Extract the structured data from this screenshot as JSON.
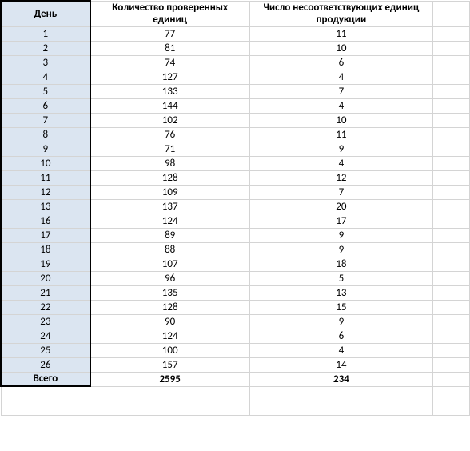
{
  "headers": {
    "day": "День",
    "checked": "Количество проверенных единиц",
    "defective": "Число несоответствующих единиц продукции"
  },
  "rows": [
    {
      "day": "1",
      "checked": "77",
      "defective": "11"
    },
    {
      "day": "2",
      "checked": "81",
      "defective": "10"
    },
    {
      "day": "3",
      "checked": "74",
      "defective": "6"
    },
    {
      "day": "4",
      "checked": "127",
      "defective": "4"
    },
    {
      "day": "5",
      "checked": "133",
      "defective": "7"
    },
    {
      "day": "6",
      "checked": "144",
      "defective": "4"
    },
    {
      "day": "7",
      "checked": "102",
      "defective": "10"
    },
    {
      "day": "8",
      "checked": "76",
      "defective": "11"
    },
    {
      "day": "9",
      "checked": "71",
      "defective": "9"
    },
    {
      "day": "10",
      "checked": "98",
      "defective": "4"
    },
    {
      "day": "11",
      "checked": "128",
      "defective": "12"
    },
    {
      "day": "12",
      "checked": "109",
      "defective": "7"
    },
    {
      "day": "13",
      "checked": "137",
      "defective": "20"
    },
    {
      "day": "16",
      "checked": "124",
      "defective": "17"
    },
    {
      "day": "17",
      "checked": "89",
      "defective": "9"
    },
    {
      "day": "18",
      "checked": "88",
      "defective": "9"
    },
    {
      "day": "19",
      "checked": "107",
      "defective": "18"
    },
    {
      "day": "20",
      "checked": "96",
      "defective": "5"
    },
    {
      "day": "21",
      "checked": "135",
      "defective": "13"
    },
    {
      "day": "22",
      "checked": "128",
      "defective": "15"
    },
    {
      "day": "23",
      "checked": "90",
      "defective": "9"
    },
    {
      "day": "24",
      "checked": "124",
      "defective": "6"
    },
    {
      "day": "25",
      "checked": "100",
      "defective": "4"
    },
    {
      "day": "26",
      "checked": "157",
      "defective": "14"
    }
  ],
  "totals": {
    "label": "Всего",
    "checked": "2595",
    "defective": "234"
  },
  "chart_data": {
    "type": "table",
    "title": "",
    "columns": [
      "День",
      "Количество проверенных единиц",
      "Число несоответствующих единиц продукции"
    ],
    "data": [
      [
        1,
        77,
        11
      ],
      [
        2,
        81,
        10
      ],
      [
        3,
        74,
        6
      ],
      [
        4,
        127,
        4
      ],
      [
        5,
        133,
        7
      ],
      [
        6,
        144,
        4
      ],
      [
        7,
        102,
        10
      ],
      [
        8,
        76,
        11
      ],
      [
        9,
        71,
        9
      ],
      [
        10,
        98,
        4
      ],
      [
        11,
        128,
        12
      ],
      [
        12,
        109,
        7
      ],
      [
        13,
        137,
        20
      ],
      [
        16,
        124,
        17
      ],
      [
        17,
        89,
        9
      ],
      [
        18,
        88,
        9
      ],
      [
        19,
        107,
        18
      ],
      [
        20,
        96,
        5
      ],
      [
        21,
        135,
        13
      ],
      [
        22,
        128,
        15
      ],
      [
        23,
        90,
        9
      ],
      [
        24,
        124,
        6
      ],
      [
        25,
        100,
        4
      ],
      [
        26,
        157,
        14
      ]
    ],
    "totals": [
      "Всего",
      2595,
      234
    ]
  }
}
